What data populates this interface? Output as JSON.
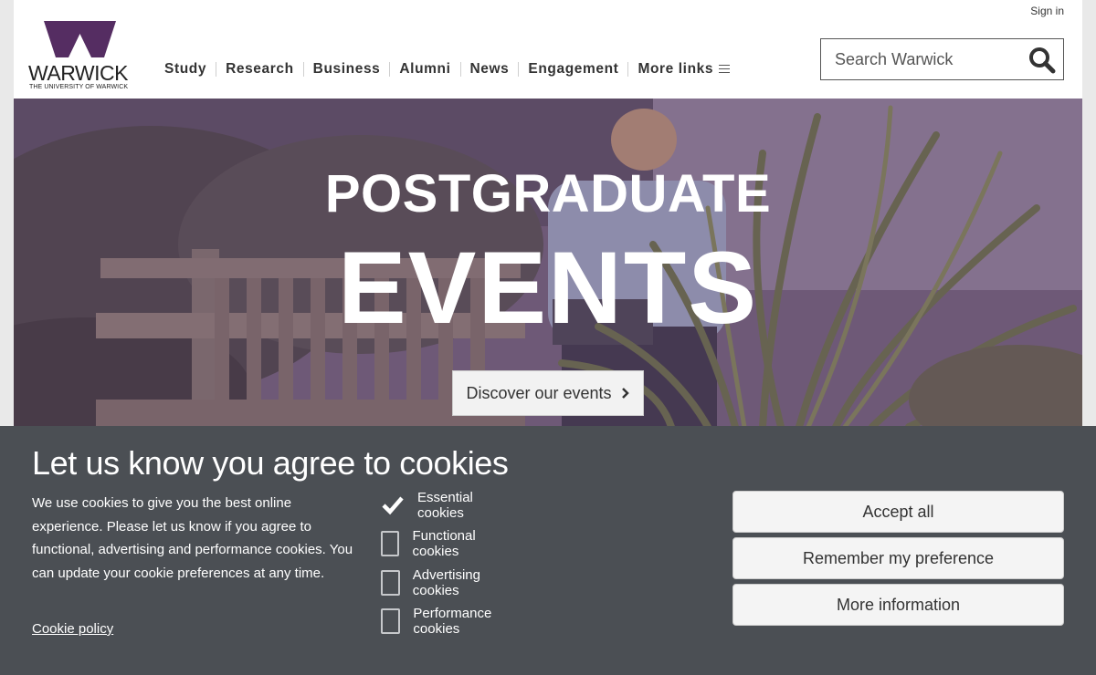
{
  "header": {
    "signin_label": "Sign in",
    "logo": {
      "wordmark": "WARWICK",
      "subtitle": "THE UNIVERSITY OF WARWICK",
      "brand_color": "#552d62"
    },
    "nav": [
      {
        "label": "Study"
      },
      {
        "label": "Research"
      },
      {
        "label": "Business"
      },
      {
        "label": "Alumni"
      },
      {
        "label": "News"
      },
      {
        "label": "Engagement"
      },
      {
        "label": "More links"
      }
    ],
    "search": {
      "placeholder": "Search Warwick",
      "value": ""
    }
  },
  "hero": {
    "title_small": "POSTGRADUATE",
    "title_large": "EVENTS",
    "cta_label": "Discover our events",
    "tint_color": "#583a68"
  },
  "cookie_banner": {
    "heading": "Let us know you agree to cookies",
    "description": "We use cookies to give you the best online experience. Please let us know if you agree to functional, advertising and performance cookies. You can update your cookie preferences at any time.",
    "policy_link": "Cookie policy",
    "options": [
      {
        "label": "Essential cookies",
        "checked": true
      },
      {
        "label": "Functional cookies",
        "checked": false
      },
      {
        "label": "Advertising cookies",
        "checked": false
      },
      {
        "label": "Performance cookies",
        "checked": false
      }
    ],
    "buttons": {
      "accept_all": "Accept all",
      "remember": "Remember my preference",
      "more_info": "More information"
    },
    "background_color": "#4b4f54"
  }
}
